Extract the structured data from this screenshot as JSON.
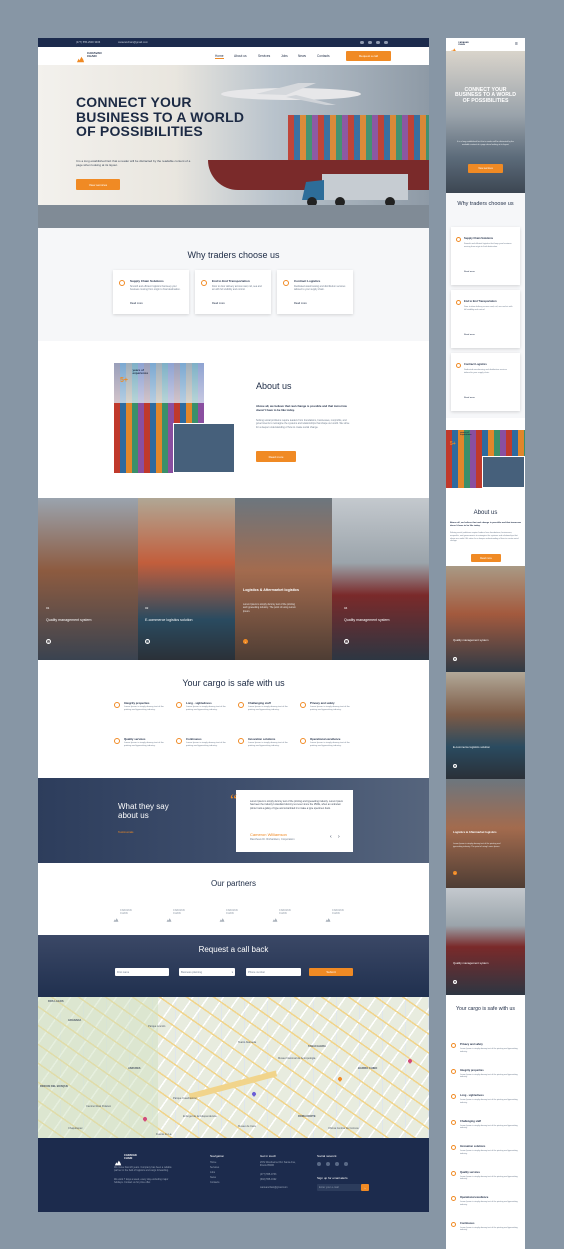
{
  "brand": {
    "name_line1": "CARAVAN",
    "name_line2": "CHAIN",
    "accent": "#f08a24",
    "navy": "#1c2b4d"
  },
  "topbar": {
    "phone": "(477) 555-2930 3466",
    "email": "caravanchain@gmail.com"
  },
  "nav": {
    "items": [
      "Home",
      "About us",
      "Services",
      "Jobs",
      "News",
      "Contacts"
    ],
    "cta": "Request a call"
  },
  "hero": {
    "title_l1": "CONNECT YOUR",
    "title_l2": "BUSINESS TO A WORLD",
    "title_l3": "OF POSSIBILITIES",
    "text": "It is a long established fact that a reader will be distracted by the readable content of a page when looking at its layout.",
    "button": "View services"
  },
  "why": {
    "title": "Why traders choose us",
    "cards": [
      {
        "title": "Supply Chain Solutions",
        "text": "Smooth and efficient logistics that keep your business moving from origin to final destination.",
        "more": "Read more"
      },
      {
        "title": "End to End Transportation",
        "text": "Door to door delivery across road, rail, sea and air with full visibility and control.",
        "more": "Read more"
      },
      {
        "title": "Contract Logistics",
        "text": "Dedicated warehousing and distribution services tailored to your supply chain.",
        "more": "Read more"
      }
    ]
  },
  "about": {
    "badge_num": "5+",
    "badge_l1": "years of",
    "badge_l2": "experience",
    "title": "About us",
    "lead": "Above all, we believe that real change is possible and that tomorrow doesn't have to be like today.",
    "text": "Solving social problems require leaders from foundations, businesses, nonprofits, and governments to reimagine the systems and relationships that shape our world. We strive for a deeper understanding of how to create social change.",
    "button": "Read more"
  },
  "services": [
    {
      "num": "01",
      "title": "Quality management system"
    },
    {
      "num": "02",
      "title": "E-commerce logistics solution"
    },
    {
      "num": "03",
      "title": "Logistics & Aftermarket logistics",
      "text": "Lorem Ipsum is simply dummy text of the printing and typesetting industry. The point of using Lorem Ipsum."
    },
    {
      "num": "04",
      "title": "Quality management system"
    }
  ],
  "safe": {
    "title": "Your cargo is safe with us",
    "items": [
      {
        "title": "Integrity properties",
        "text": "Lorem Ipsum is simply dummy text of the printing and typesetting industry."
      },
      {
        "title": "Long - sightedness",
        "text": "Lorem Ipsum is simply dummy text of the printing and typesetting industry."
      },
      {
        "title": "Challenging staff",
        "text": "Lorem Ipsum is simply dummy text of the printing and typesetting industry."
      },
      {
        "title": "Privacy and safety",
        "text": "Lorem Ipsum is simply dummy text of the printing and typesetting industry."
      },
      {
        "title": "Quality services",
        "text": "Lorem Ipsum is simply dummy text of the printing and typesetting industry."
      },
      {
        "title": "Continuous",
        "text": "Lorem Ipsum is simply dummy text of the printing and typesetting industry."
      },
      {
        "title": "Innovation solutions",
        "text": "Lorem Ipsum is simply dummy text of the printing and typesetting industry."
      },
      {
        "title": "Operational excellence",
        "text": "Lorem Ipsum is simply dummy text of the printing and typesetting industry."
      }
    ]
  },
  "testimonial": {
    "title_l1": "What they say",
    "title_l2": "about us",
    "link": "Testimonials",
    "quote": "Lorem Ipsum is simply dummy text of the printing and typesetting industry. Lorem Ipsum has been the industry's standard dummy text ever since the 1500s, when an unknown printer took a galley of type and scrambled it to make a type specimen book.",
    "author": "Cameron Williamson",
    "role": "Rancheve Dr. Richardson, Corporation"
  },
  "partners": {
    "title": "Our partners",
    "count": 5
  },
  "callback": {
    "title": "Request a call back",
    "first_name": "First name",
    "select": "Business planning",
    "phone": "Phone number",
    "submit": "Submit"
  },
  "map": {
    "labels": [
      "DOS LAGOS",
      "GRANADA",
      "Parque Lincoln",
      "Teatro Alameda",
      "ANZURES",
      "RINCON DEL BOSQUE",
      "Camino Real Polanco",
      "TABACALERA",
      "BARRIO CHINO",
      "Museo Nacional de Antropologia",
      "Parque Cuauhtemoc",
      "El Angel de la Independencia",
      "Museo de Cera",
      "Fuente de La",
      "Chapultepec",
      "ROMA NORTE",
      "Oficina Central de Correos"
    ]
  },
  "footer": {
    "about": "We move Fast 20 years. Company has been a reliable partner in the field of logistics and cargo forwarding.",
    "hours": "We work 7 days a week, every day excluding major holidays. Contact us for price offer.",
    "nav_title": "Navigation",
    "nav_items": [
      "Home",
      "Services",
      "Jobs",
      "News",
      "Contacts"
    ],
    "touch_title": "Get in touch",
    "address": "2972 Westheimer Rd. Santa Ana, Illinois 85486",
    "phone1": "(477) 555-0733",
    "phone2": "(602) 555-0192",
    "email": "caravanchain@gmail.com",
    "social_title": "Social network",
    "subscribe_title": "Sign up for email alerts",
    "subscribe_placeholder": "Enter your e-mail"
  },
  "mobile": {
    "safe_items": [
      "Privacy and safety",
      "Integrity properties",
      "Long - sightedness",
      "Challenging staff",
      "Innovation solutions",
      "Quality services",
      "Operational excellence",
      "Continuous"
    ]
  }
}
